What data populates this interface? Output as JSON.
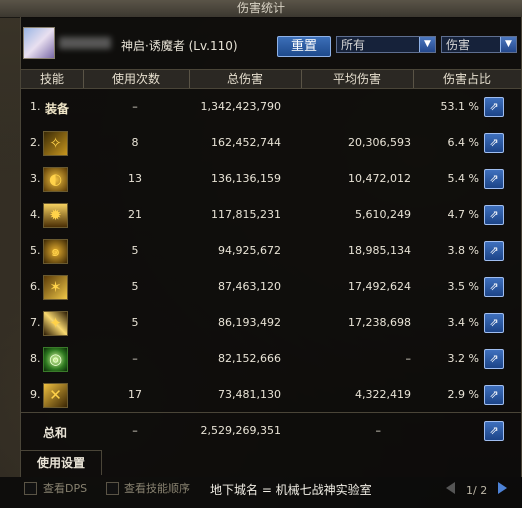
{
  "window": {
    "title": "伤害统计"
  },
  "header": {
    "character_name": "神启·诱魔者 (Lv.110)",
    "reset_label": "重置",
    "filter_select": "所有",
    "metric_select": "伤害"
  },
  "columns": {
    "skill": "技能",
    "uses": "使用次数",
    "total": "总伤害",
    "avg": "平均伤害",
    "share": "伤害占比"
  },
  "rows": [
    {
      "rank": "1.",
      "label": "装备",
      "uses": "–",
      "total": "1,342,423,790",
      "avg": "",
      "pct": "53.1 %"
    },
    {
      "rank": "2.",
      "uses": "8",
      "total": "162,452,744",
      "avg": "20,306,593",
      "pct": "6.4 %"
    },
    {
      "rank": "3.",
      "uses": "13",
      "total": "136,136,159",
      "avg": "10,472,012",
      "pct": "5.4 %"
    },
    {
      "rank": "4.",
      "uses": "21",
      "total": "117,815,231",
      "avg": "5,610,249",
      "pct": "4.7 %"
    },
    {
      "rank": "5.",
      "uses": "5",
      "total": "94,925,672",
      "avg": "18,985,134",
      "pct": "3.8 %"
    },
    {
      "rank": "6.",
      "uses": "5",
      "total": "87,463,120",
      "avg": "17,492,624",
      "pct": "3.5 %"
    },
    {
      "rank": "7.",
      "uses": "5",
      "total": "86,193,492",
      "avg": "17,238,698",
      "pct": "3.4 %"
    },
    {
      "rank": "8.",
      "uses": "–",
      "total": "82,152,666",
      "avg": "–",
      "pct": "3.2 %"
    },
    {
      "rank": "9.",
      "uses": "17",
      "total": "73,481,130",
      "avg": "4,322,419",
      "pct": "2.9 %"
    }
  ],
  "summary": {
    "label": "总和",
    "uses": "–",
    "total": "2,529,269,351",
    "avg": "–"
  },
  "settings_tab": "使用设置",
  "footer": {
    "view_dps": "查看DPS",
    "view_order": "查看技能顺序",
    "dungeon": "地下城名 = 机械七战神实验室",
    "page": "1/ 2"
  }
}
